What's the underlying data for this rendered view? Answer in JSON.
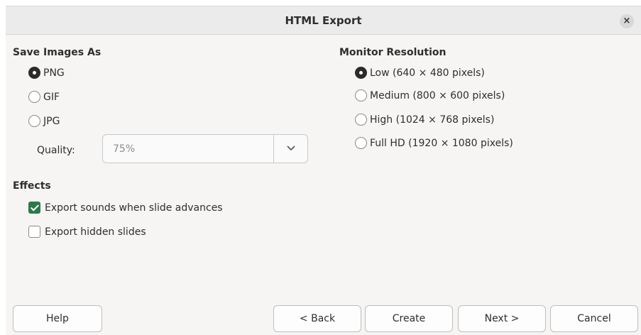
{
  "dialog": {
    "title": "HTML Export",
    "close_glyph": "×"
  },
  "save_images": {
    "title": "Save Images As",
    "options": [
      {
        "label": "PNG",
        "selected": true
      },
      {
        "label": "GIF",
        "selected": false
      },
      {
        "label": "JPG",
        "selected": false
      }
    ],
    "quality_label": "Quality:",
    "quality_value": "75%",
    "dropdown_icon": "chevron-down-icon"
  },
  "monitor": {
    "title": "Monitor Resolution",
    "options": [
      {
        "label": "Low (640 × 480 pixels)",
        "selected": true
      },
      {
        "label": "Medium (800 × 600 pixels)",
        "selected": false
      },
      {
        "label": "High (1024 × 768 pixels)",
        "selected": false
      },
      {
        "label": "Full HD (1920 × 1080 pixels)",
        "selected": false
      }
    ]
  },
  "effects": {
    "title": "Effects",
    "options": [
      {
        "label": "Export sounds when slide advances",
        "checked": true
      },
      {
        "label": "Export hidden slides",
        "checked": false
      }
    ]
  },
  "buttons": {
    "help": "Help",
    "back": "< Back",
    "create": "Create",
    "next": "Next >",
    "cancel": "Cancel"
  },
  "colors": {
    "check_accent": "#2a7a4a",
    "dialog_bg": "#f6f5f4",
    "titlebar_bg": "#ebebeb"
  }
}
